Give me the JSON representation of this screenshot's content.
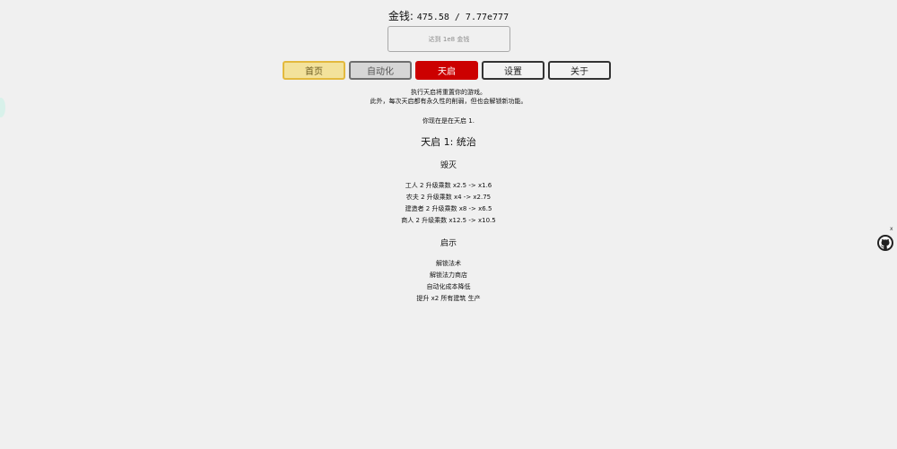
{
  "header": {
    "money_label": "金钱:",
    "money_value": "475.58 / 7.77e777"
  },
  "prestige": {
    "hint": "达到 1e8 金钱"
  },
  "tabs": [
    {
      "label": "首页"
    },
    {
      "label": "自动化"
    },
    {
      "label": "天启"
    },
    {
      "label": "设置"
    },
    {
      "label": "关于"
    }
  ],
  "apocalypse": {
    "desc_line1": "执行天启将重置你的游戏。",
    "desc_line2": "此外，每次天启都有永久性的削弱，但也会解锁新功能。",
    "current": "你现在是在天启 1.",
    "title": "天启 1: 统治",
    "destroy_heading": "毁灭",
    "destroy_items": [
      "工人 2 升级乘数 x2.5 -> x1.6",
      "农夫 2 升级乘数 x4 -> x2.75",
      "建造者 2 升级乘数 x8 -> x6.5",
      "商人 2 升级乘数 x12.5 -> x10.5"
    ],
    "reveal_heading": "启示",
    "reveal_items": [
      "解锁法术",
      "解锁法力商店",
      "自动化成本降低",
      "提升 x2 所有建筑 生产"
    ]
  },
  "helper": {
    "close": "x",
    "icon": "octocat-icon"
  },
  "colors": {
    "background": "#f0f0f0",
    "home_tab": "#f3e29b",
    "automation_tab": "#d6d6d6",
    "apocalypse_tab": "#cc0000"
  }
}
